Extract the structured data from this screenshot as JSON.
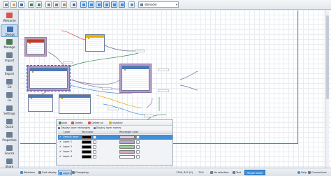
{
  "app": {
    "name": "DbSchema"
  },
  "toolbar": {
    "combo_value": "dbmodel",
    "buttons": [
      {
        "name": "new-file-icon",
        "color": "#6b7d93"
      },
      {
        "name": "open-folder-icon",
        "color": "#d8a531"
      },
      {
        "name": "save-icon",
        "color": "#3d6fb0"
      },
      {
        "name": "undo-icon",
        "color": "#3d8a55"
      },
      {
        "name": "redo-icon",
        "color": "#3d8a55"
      },
      {
        "name": "cut-icon",
        "color": "#7a7a7a"
      },
      {
        "name": "copy-icon",
        "color": "#7a7a7a"
      },
      {
        "name": "paste-icon",
        "color": "#b9884a"
      },
      {
        "name": "find-icon",
        "color": "#4e6e94"
      },
      {
        "name": "add-table-icon",
        "color": "#3f8fd8"
      },
      {
        "name": "add-view-icon",
        "color": "#3f8fd8"
      },
      {
        "name": "add-relation-icon",
        "color": "#3f8fd8"
      },
      {
        "name": "add-group-icon",
        "color": "#3f8fd8"
      },
      {
        "name": "add-note-icon",
        "color": "#3f8fd8"
      },
      {
        "name": "add-query-icon",
        "color": "#3f8fd8"
      },
      {
        "name": "layout-icon",
        "color": "#3f8fd8"
      },
      {
        "name": "zoom-icon",
        "color": "#6b7d93"
      },
      {
        "name": "print-icon",
        "color": "#6b7d93"
      }
    ]
  },
  "sidebar": {
    "items": [
      {
        "label": "Welcome",
        "icon": "welcome-icon",
        "color": "#d9534f"
      },
      {
        "label": "Design",
        "icon": "design-icon",
        "color": "#3d6fb0",
        "active": true
      },
      {
        "label": "Manage",
        "icon": "manage-icon",
        "color": "#4b7a4f"
      },
      {
        "label": "Import",
        "icon": "import-icon",
        "color": "#6b7d93"
      },
      {
        "label": "Export",
        "icon": "export-icon",
        "color": "#6b7d93"
      },
      {
        "label": "Git",
        "icon": "git-icon",
        "color": "#6b7d93"
      },
      {
        "label": "Fix",
        "icon": "fix-icon",
        "color": "#6b7d93"
      },
      {
        "label": "Settings",
        "icon": "settings-icon",
        "color": "#6b7d93"
      },
      {
        "label": "Quick",
        "icon": "quick-icon",
        "color": "#6b7d93"
      },
      {
        "label": "Properties",
        "icon": "properties-icon",
        "color": "#6b7d93"
      },
      {
        "label": "Source",
        "icon": "source-icon",
        "color": "#6b7d93"
      },
      {
        "label": "Share",
        "icon": "share-icon",
        "color": "#6b7d93"
      }
    ]
  },
  "colors": {
    "accent": "#3f8fd8",
    "table_header_blue": "#4a78b8",
    "table_header_red": "#c0392b",
    "table_header_yellow": "#e2b400",
    "page_border": "#d9534f"
  },
  "diagram": {
    "tables": [
      {
        "id": "t-red",
        "name": "",
        "header_color": "#c0392b",
        "rows": 5
      },
      {
        "id": "t-yellow",
        "name": "",
        "header_color": "#e2b400",
        "rows": 6
      },
      {
        "id": "t-left",
        "name": "",
        "header_color": "#4a78b8",
        "rows": 8
      },
      {
        "id": "t-right",
        "name": "",
        "header_color": "#4a78b8",
        "rows": 9
      },
      {
        "id": "t-bottom1",
        "name": "",
        "header_color": "#4a78b8",
        "rows": 6
      },
      {
        "id": "t-bottom2",
        "name": "",
        "header_color": "#4a78b8",
        "rows": 7
      }
    ],
    "labels": [
      "",
      "",
      "",
      "",
      "",
      "",
      ""
    ]
  },
  "layers_panel": {
    "tabs": [
      {
        "label": "Add",
        "icon": "add-icon",
        "color": "#3d8a55"
      },
      {
        "label": "Delete",
        "icon": "delete-icon",
        "color": "#d9534f"
      },
      {
        "label": "Delete all",
        "icon": "delete-all-icon",
        "color": "#d9534f"
      },
      {
        "label": "Visibility",
        "icon": "visibility-icon",
        "color": "#e2b400"
      }
    ],
    "options": [
      {
        "label": "Display layer rectangles",
        "checked": true
      },
      {
        "label": "Display layer names",
        "checked": true
      }
    ],
    "columns": [
      "Layer",
      "Text color",
      "Rectangle color"
    ],
    "rows": [
      {
        "name": "Default layer",
        "checked": true,
        "selected": true,
        "text_color": "#000000",
        "rect_color": "#d8c9ef"
      },
      {
        "name": "Layer 1",
        "checked": true,
        "selected": false,
        "text_color": "#000000",
        "rect_color": "#b4a2d8"
      },
      {
        "name": "Layer 2",
        "checked": true,
        "selected": false,
        "text_color": "#000000",
        "rect_color": "#8fd27e"
      },
      {
        "name": "Layer 3",
        "checked": true,
        "selected": false,
        "text_color": "#000000",
        "rect_color": "#c9a8c0"
      },
      {
        "name": "Layer 4",
        "checked": true,
        "selected": false,
        "text_color": "#000000",
        "rect_color": "#ffffff"
      }
    ]
  },
  "statusbar": {
    "items": [
      {
        "label": "Relations",
        "icon": "relations-icon",
        "color": "#3f8fd8"
      },
      {
        "label": "Grid display",
        "icon": "grid-icon",
        "color": "#6b7d93"
      },
      {
        "label": "Layers",
        "icon": "layers-icon",
        "color": "#3f8fd8",
        "pressed": true
      },
      {
        "label": "Changelog",
        "icon": "changelog-icon",
        "color": "#6b7d93"
      }
    ],
    "coords": "1790, 847 (X)",
    "zoom": "70%",
    "right_items": [
      {
        "label": "No selection",
        "icon": "selection-icon",
        "color": "#6b7d93"
      },
      {
        "label": "Text",
        "icon": "text-icon",
        "color": "#6b7d93"
      }
    ],
    "mode": "Single mode",
    "help": "Help",
    "reconnect": "Connections"
  }
}
